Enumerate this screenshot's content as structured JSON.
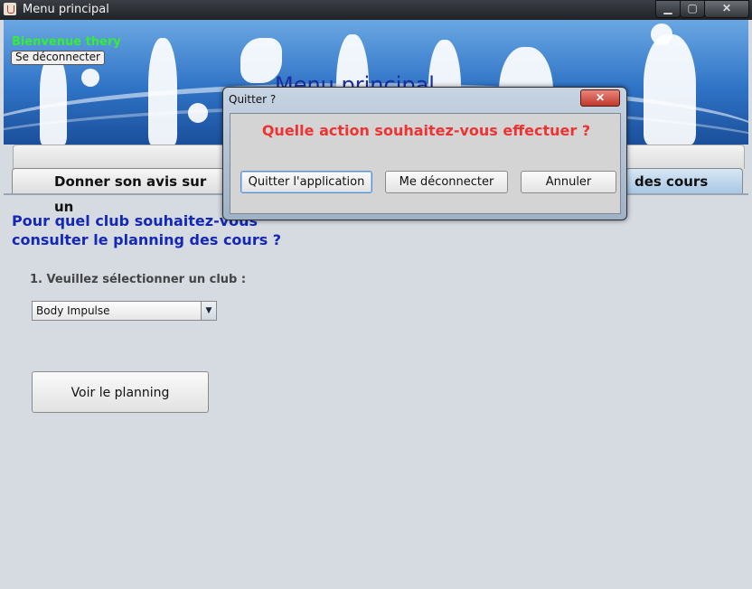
{
  "window": {
    "title": "Menu principal",
    "minimize_glyph": "▁",
    "maximize_glyph": "▢",
    "close_glyph": "✕"
  },
  "banner": {
    "welcome": "Bienvenue thery",
    "logout_label": "Se déconnecter",
    "title": "Menu principal"
  },
  "tabs": [
    {
      "label": "Donner son avis sur un"
    },
    {
      "label": "des cours"
    }
  ],
  "main": {
    "heading_line1": "Pour quel club souhaitez-vous",
    "heading_line2": "consulter le planning des cours ?",
    "step_label": "1. Veuillez sélectionner un club :",
    "club_select_value": "Body Impulse",
    "view_button": "Voir le planning"
  },
  "dialog": {
    "title": "Quitter ?",
    "close_glyph": "✕",
    "question": "Quelle action souhaitez-vous effectuer ?",
    "buttons": {
      "quit": "Quitter l'application",
      "logout": "Me déconnecter",
      "cancel": "Annuler"
    }
  },
  "colors": {
    "welcome": "#33ee33",
    "heading": "#1428b8",
    "question": "#ee3333"
  }
}
